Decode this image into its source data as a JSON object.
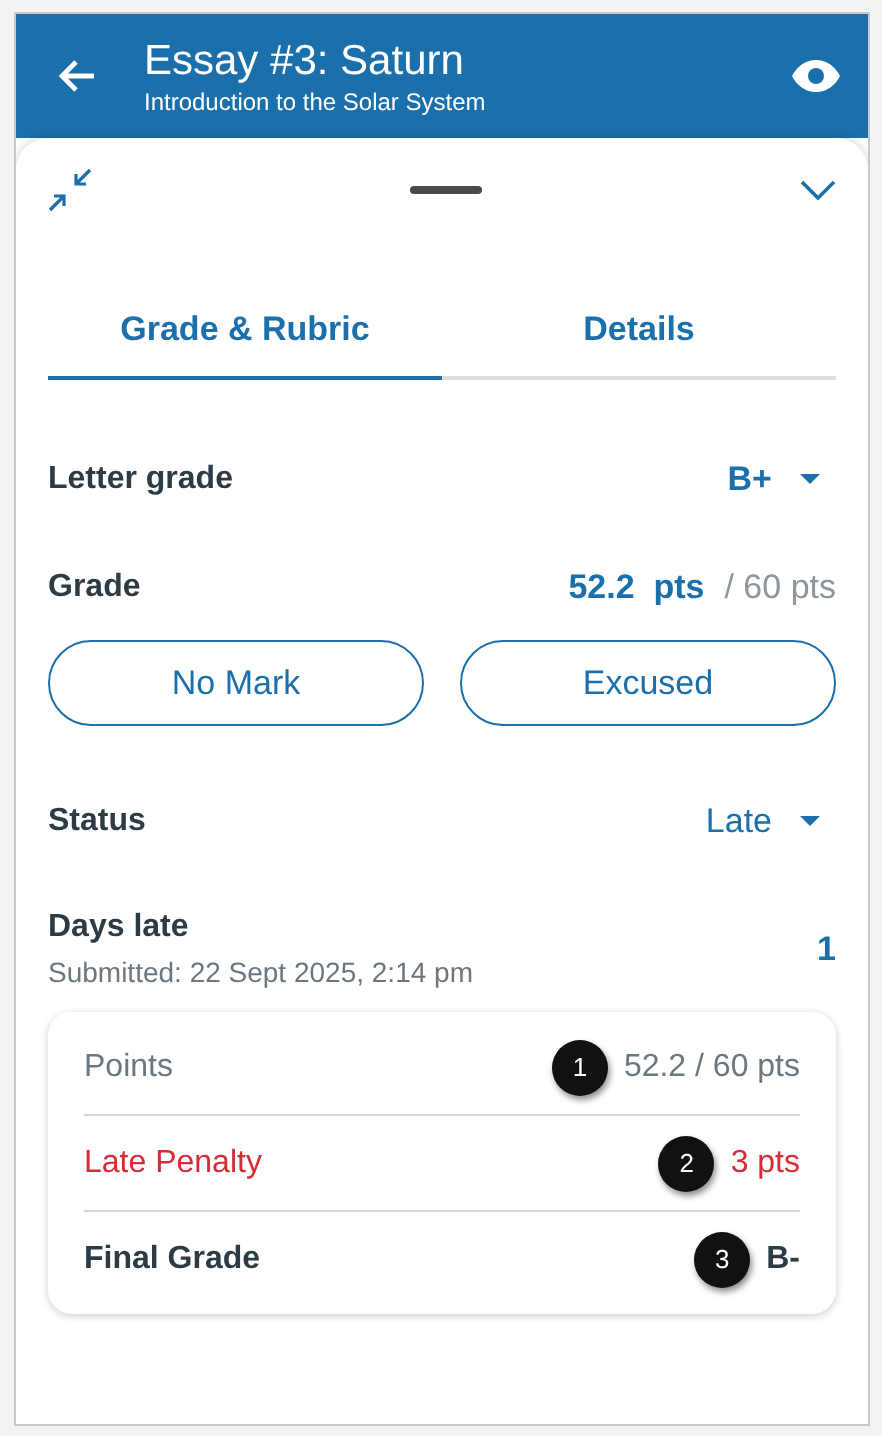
{
  "header": {
    "title": "Essay #3: Saturn",
    "subtitle": "Introduction to the Solar System"
  },
  "tabs": [
    {
      "label": "Grade & Rubric",
      "selected": true
    },
    {
      "label": "Details",
      "selected": false
    }
  ],
  "letter_grade": {
    "label": "Letter grade",
    "value": "B+"
  },
  "grade": {
    "label": "Grade",
    "score": "52.2  pts",
    "total": "/ 60 pts"
  },
  "buttons": [
    "No Mark",
    "Excused"
  ],
  "status": {
    "label": "Status",
    "value": "Late"
  },
  "days_late": {
    "label": "Days late",
    "submitted": "Submitted: 22 Sept 2025, 2:14 pm",
    "value": "1"
  },
  "summary": [
    {
      "kind": "normal",
      "label": "Points",
      "value": "52.2 / 60 pts",
      "callout": "1"
    },
    {
      "kind": "penalty",
      "label": "Late Penalty",
      "value": "3 pts",
      "callout": "2"
    },
    {
      "kind": "total",
      "label": "Final Grade",
      "value": "B-",
      "callout": "3"
    }
  ]
}
